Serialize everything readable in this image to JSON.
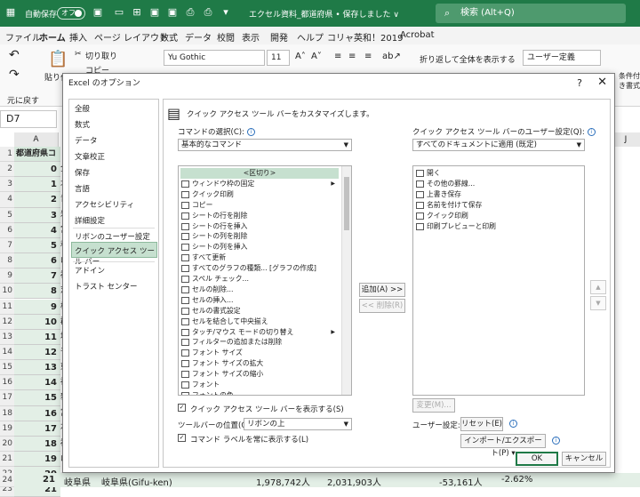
{
  "titlebar": {
    "autosave_label": "自動保存",
    "autosave_state": "オフ",
    "document_title": "エクセル資料_都道府県 • 保存しました ∨",
    "search_placeholder": "検索 (Alt+Q)"
  },
  "ribbon_tabs": [
    "ファイル",
    "ホーム",
    "挿入",
    "ページ レイアウト",
    "数式",
    "データ",
    "校閲",
    "表示",
    "開発",
    "ヘルプ",
    "コリャ英和！2019",
    "Acrobat"
  ],
  "ribbon": {
    "undo_label": "元に戻す",
    "paste_label": "貼り付け",
    "cut_label": "切り取り",
    "copy_label": "コピー",
    "font_name": "Yu Gothic",
    "font_size": "11",
    "wrap_text": "折り返して全体を表示する",
    "number_format": "ユーザー定義",
    "conditional_format": "条件付き書式"
  },
  "sheet": {
    "name_box": "D7",
    "col_a": "A",
    "col_j": "J",
    "header_cell": "都道府県コ",
    "row_numbers": [
      "1",
      "2",
      "3",
      "4",
      "5",
      "6",
      "7",
      "8",
      "9",
      "10",
      "11",
      "12",
      "13",
      "14",
      "15",
      "16",
      "17",
      "18",
      "19",
      "20",
      "21",
      "22",
      "23"
    ],
    "col_a_values": [
      "都道府県コ",
      "0",
      "1",
      "2",
      "3",
      "4",
      "5",
      "6",
      "7",
      "8",
      "9",
      "10",
      "11",
      "12",
      "13",
      "14",
      "15",
      "16",
      "17",
      "18",
      "19",
      "20",
      "21"
    ],
    "col_b_glimpse": [
      "全",
      "北",
      "青",
      "岩",
      "宮",
      "秋",
      "山",
      "福",
      "茨",
      "栃",
      "群",
      "埼",
      "千",
      "東",
      "神",
      "新",
      "富",
      "石",
      "福",
      "山",
      "長"
    ],
    "last_row": {
      "num": "24",
      "code": "21",
      "pref": "岐阜県",
      "pref_en": "岐阜県(Gifu-ken)",
      "v1": "1,978,742人",
      "v2": "2,031,903人",
      "diff": "-53,161人",
      "pct": "-2.62%"
    }
  },
  "dialog": {
    "title": "Excel のオプション",
    "help": "?",
    "close": "✕",
    "nav": [
      "全般",
      "数式",
      "データ",
      "文章校正",
      "保存",
      "言語",
      "アクセシビリティ",
      "詳細設定",
      "リボンのユーザー設定",
      "クイック アクセス ツール バー",
      "アドイン",
      "トラスト センター"
    ],
    "heading": "クイック アクセス ツール バーをカスタマイズします。",
    "choose_label": "コマンドの選択(C):",
    "choose_value": "基本的なコマンド",
    "customize_label": "クイック アクセス ツール バーのユーザー設定(Q):",
    "customize_value": "すべてのドキュメントに適用 (既定)",
    "commands": [
      "<区切り>",
      "ウィンドウ枠の固定",
      "クイック印刷",
      "コピー",
      "シートの行を削除",
      "シートの行を挿入",
      "シートの列を削除",
      "シートの列を挿入",
      "すべて更新",
      "すべてのグラフの種類... [グラフの作成]",
      "スペル チェック...",
      "セルの削除...",
      "セルの挿入...",
      "セルの書式設定",
      "セルを結合して中央揃え",
      "タッチ/マウス モードの切り替え",
      "フィルターの追加または削除",
      "フォント サイズ",
      "フォント サイズの拡大",
      "フォント サイズの縮小",
      "フォント",
      "フォントの色"
    ],
    "qat_items": [
      "開く",
      "その他の罫線...",
      "上書き保存",
      "名前を付けて保存",
      "クイック印刷",
      "印刷プレビューと印刷"
    ],
    "add_button": "追加(A) >>",
    "remove_button": "<< 削除(R)",
    "modify_button": "変更(M)...",
    "show_below_label": "クイック アクセス ツール バーを表示する(S)",
    "toolbar_pos_label": "ツールバーの位置(Q)",
    "toolbar_pos_value": "リボンの上",
    "show_labels_label": "コマンド ラベルを常に表示する(L)",
    "user_settings_label": "ユーザー設定:",
    "reset_button": "リセット(E) ▾",
    "import_export_button": "インポート/エクスポート(P) ▾",
    "ok_button": "OK",
    "cancel_button": "キャンセル"
  }
}
